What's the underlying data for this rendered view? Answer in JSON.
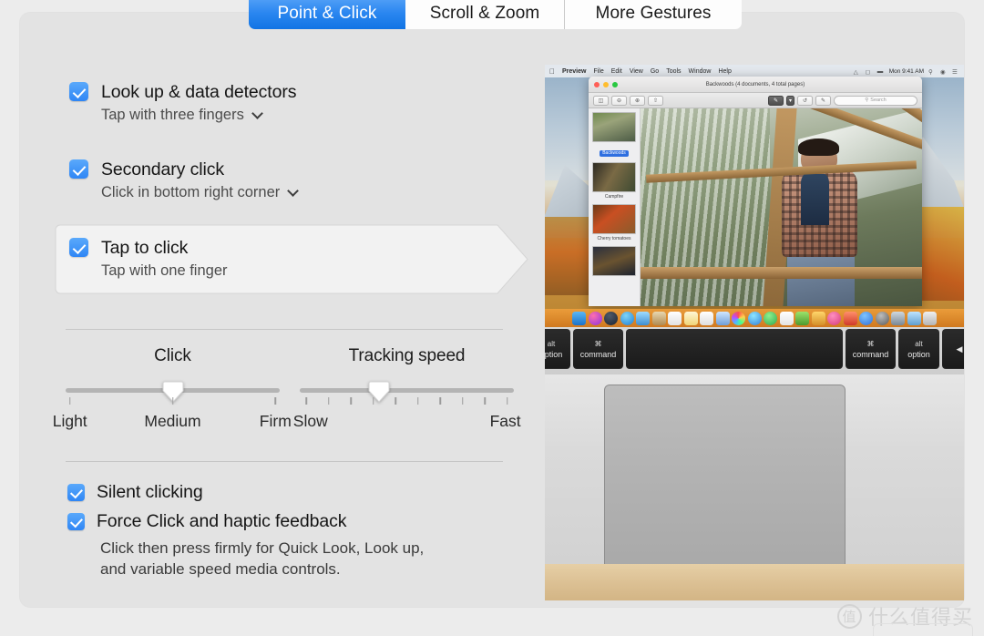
{
  "tabs": [
    {
      "label": "Point & Click",
      "active": true
    },
    {
      "label": "Scroll & Zoom",
      "active": false
    },
    {
      "label": "More Gestures",
      "active": false
    }
  ],
  "options": [
    {
      "title": "Look up & data detectors",
      "subtitle": "Tap with three fingers",
      "checked": true,
      "has_menu": true,
      "highlighted": false
    },
    {
      "title": "Secondary click",
      "subtitle": "Click in bottom right corner",
      "checked": true,
      "has_menu": true,
      "highlighted": false
    },
    {
      "title": "Tap to click",
      "subtitle": "Tap with one finger",
      "checked": true,
      "has_menu": false,
      "highlighted": true
    }
  ],
  "sliders": {
    "click": {
      "label": "Click",
      "ticks": [
        "Light",
        "Medium",
        "Firm"
      ],
      "tick_count": 3,
      "value_label": "Medium",
      "value_percent": 50
    },
    "tracking": {
      "label": "Tracking speed",
      "min_label": "Slow",
      "max_label": "Fast",
      "tick_count": 10,
      "value_percent": 37
    }
  },
  "toggles": [
    {
      "label": "Silent clicking",
      "checked": true
    },
    {
      "label": "Force Click and haptic feedback",
      "checked": true
    }
  ],
  "helper_text": {
    "line1": "Click then press firmly for Quick Look, Look up,",
    "line2": "and variable speed media controls."
  },
  "preview": {
    "menubar": {
      "apple": "apple-logo",
      "items": [
        "Preview",
        "File",
        "Edit",
        "View",
        "Go",
        "Tools",
        "Window",
        "Help"
      ],
      "clock": "Mon 9:41 AM",
      "status_icons": [
        "wifi-icon",
        "airplay-icon",
        "battery-icon",
        "spotlight-icon",
        "siri-icon",
        "control-center-icon"
      ]
    },
    "window": {
      "title": "Backwoods (4 documents, 4 total pages)",
      "search_placeholder": "Search",
      "thumbnails": [
        {
          "caption": "Backwoods",
          "selected": true
        },
        {
          "caption": "Campfire",
          "selected": false
        },
        {
          "caption": "Cherry tomatoes",
          "selected": false
        },
        {
          "caption": "",
          "selected": false
        }
      ]
    },
    "keyboard": [
      {
        "top": "alt",
        "bottom": "option"
      },
      {
        "top": "⌘",
        "bottom": "command"
      },
      {
        "top": "",
        "bottom": ""
      },
      {
        "top": "⌘",
        "bottom": "command"
      },
      {
        "top": "alt",
        "bottom": "option"
      },
      {
        "top": "",
        "bottom": "◀"
      }
    ]
  },
  "watermark": {
    "logo_char": "值",
    "text": "什么值得买"
  },
  "colors": {
    "accent_blue": "#2f86f5",
    "tab_active_blue": "#2a86f0",
    "panel_bg": "#e3e3e3",
    "page_bg": "#ececec",
    "highlight_bg": "#f2f2f2"
  }
}
